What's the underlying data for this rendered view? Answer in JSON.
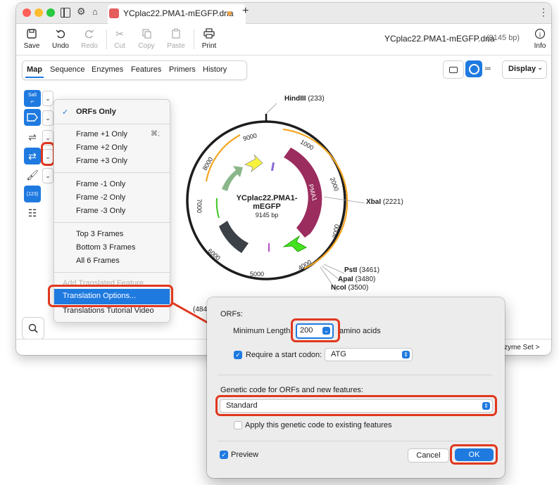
{
  "window": {
    "tab_title": "YCplac22.PMA1-mEGFP.dna",
    "plus": "+",
    "more": "⋮",
    "file_name": "YCplac22.PMA1-mEGFP.dna",
    "file_size": "(9145 bp)",
    "info_label": "Info"
  },
  "toolbar": {
    "save": "Save",
    "undo": "Undo",
    "redo": "Redo",
    "cut": "Cut",
    "copy": "Copy",
    "paste": "Paste",
    "print": "Print"
  },
  "view_tabs": [
    "Map",
    "Sequence",
    "Enzymes",
    "Features",
    "Primers",
    "History"
  ],
  "display_label": "Display",
  "sidebar": {
    "sall": "SalI",
    "num_label": "(123)"
  },
  "map": {
    "name_line1": "YCplac22.PMA1-",
    "name_line2": "mEGFP",
    "length": "9145 bp",
    "ticks": [
      "1000",
      "2000",
      "3000",
      "4000",
      "5000",
      "6000",
      "7000",
      "8000",
      "9000"
    ],
    "features": {
      "pma1": "PMA1",
      "cen": "CEN/..."
    },
    "sites": [
      {
        "name": "HindIII",
        "pos": "(233)"
      },
      {
        "name": "XbaI",
        "pos": "(2221)"
      },
      {
        "name": "PstI",
        "pos": "(3461)"
      },
      {
        "name": "ApaI",
        "pos": "(3480)"
      },
      {
        "name": "NcoI",
        "pos": "(3500)"
      }
    ],
    "partial_label": "(484",
    "enzyme_set": "zyme Set >"
  },
  "menu": {
    "check": "✓",
    "orfs_only": "ORFs Only",
    "frames": [
      "Frame +1 Only",
      "Frame +2 Only",
      "Frame +3 Only",
      "Frame -1 Only",
      "Frame -2 Only",
      "Frame -3 Only"
    ],
    "shortcut": "⌘;",
    "multi": [
      "Top 3 Frames",
      "Bottom 3 Frames",
      "All 6 Frames"
    ],
    "add_translated": "Add Translated Feature",
    "translation_options": "Translation Options...",
    "tutorial": "Translations Tutorial Video"
  },
  "dialog": {
    "orfs_label": "ORFs:",
    "min_length_label": "Minimum Length:",
    "min_length_value": "200",
    "amino_acids": "amino acids",
    "require_start_label": "Require a start codon:",
    "start_codon": "ATG",
    "genetic_code_label": "Genetic code for ORFs and new features:",
    "genetic_code": "Standard",
    "apply_label": "Apply this genetic code to existing features",
    "preview_label": "Preview",
    "cancel": "Cancel",
    "ok": "OK"
  },
  "colors": {
    "accent": "#1f7ae0",
    "highlight": "#e0381f",
    "pma1": "#9b2c5e",
    "cen": "#3c4148",
    "egfp": "#44e31f",
    "yellow": "#f7f33c",
    "orange": "#f4a623"
  }
}
